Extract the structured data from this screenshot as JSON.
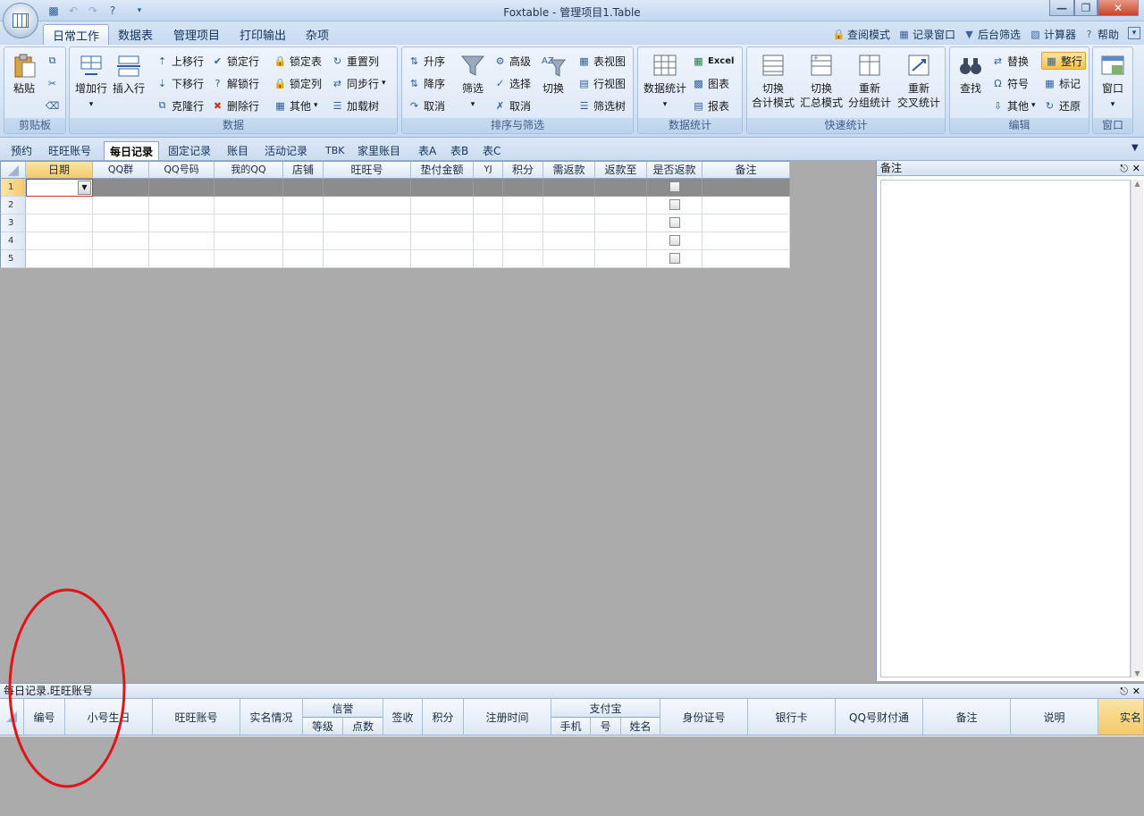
{
  "window": {
    "title": "Foxtable - 管理项目1.Table",
    "minimize_icon": "minimize-icon",
    "maximize_icon": "maximize-icon",
    "close_icon": "close-icon"
  },
  "ribbon_tabs": [
    "日常工作",
    "数据表",
    "管理项目",
    "打印输出",
    "杂项"
  ],
  "quick_links": [
    "查阅模式",
    "记录窗口",
    "后台筛选",
    "计算器",
    "帮助"
  ],
  "ribbon": {
    "clipboard": {
      "label": "剪贴板",
      "paste": "粘贴"
    },
    "data": {
      "label": "数据",
      "add_row": "增加行",
      "insert_row": "插入行",
      "move_up": "上移行",
      "move_down": "下移行",
      "clone_row": "克隆行",
      "lock_row": "锁定行",
      "unlock_row": "解锁行",
      "delete_row": "删除行",
      "lock_table": "锁定表",
      "lock_col": "锁定列",
      "other": "其他",
      "reset_col": "重置列",
      "sync_row": "同步行",
      "load_tree": "加载树"
    },
    "sort_filter": {
      "label": "排序与筛选",
      "asc": "升序",
      "desc": "降序",
      "cancel_sort": "取消",
      "filter": "筛选",
      "advanced": "高级",
      "select": "选择",
      "cancel_filter": "取消",
      "switch": "切换",
      "table_view": "表视图",
      "row_view": "行视图",
      "filter_tree": "筛选树"
    },
    "stats": {
      "label": "数据统计",
      "data_stats": "数据统计",
      "excel": "Excel",
      "chart": "图表",
      "report": "报表"
    },
    "quick_stats": {
      "label": "快速统计",
      "b1_l1": "切换",
      "b1_l2": "合计模式",
      "b2_l1": "切换",
      "b2_l2": "汇总模式",
      "b3_l1": "重新",
      "b3_l2": "分组统计",
      "b4_l1": "重新",
      "b4_l2": "交叉统计"
    },
    "edit": {
      "label": "编辑",
      "find": "查找",
      "replace": "替换",
      "symbol": "符号",
      "other": "其他",
      "whole_row": "整行",
      "mark": "标记",
      "restore": "还原"
    },
    "window": {
      "label": "窗口",
      "window": "窗口"
    }
  },
  "sheet_tabs": [
    "预约",
    "旺旺账号",
    "每日记录",
    "固定记录",
    "账目",
    "活动记录",
    "TBK",
    "家里账目",
    "表A",
    "表B",
    "表C"
  ],
  "grid": {
    "columns": [
      "日期",
      "QQ群",
      "QQ号码",
      "我的QQ",
      "店铺",
      "旺旺号",
      "垫付金额",
      "YJ",
      "积分",
      "需返款",
      "返款至",
      "是否返款",
      "备注"
    ],
    "row_numbers": [
      "1",
      "2",
      "3",
      "4",
      "5"
    ]
  },
  "notes_panel": {
    "title": "备注"
  },
  "sub_panel": {
    "title": "每日记录.旺旺账号",
    "columns": [
      "编号",
      "小号生日",
      "旺旺账号",
      "实名情况",
      "签收",
      "积分",
      "注册时间",
      "身份证号",
      "银行卡",
      "QQ号财付通",
      "备注",
      "说明",
      "实名"
    ],
    "group_credit": "信誉",
    "credit_sub": [
      "等级",
      "点数"
    ],
    "group_alipay": "支付宝",
    "alipay_sub": [
      "手机",
      "号",
      "姓名"
    ]
  }
}
